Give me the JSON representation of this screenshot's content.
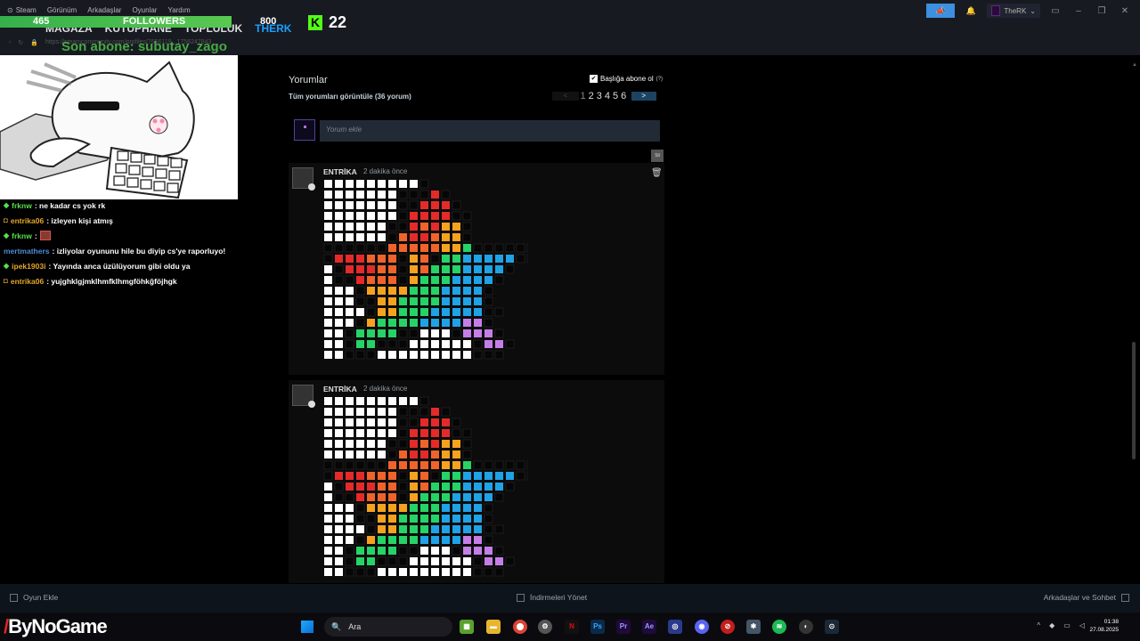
{
  "menu": {
    "app": "Steam",
    "items": [
      "Görünüm",
      "Arkadaşlar",
      "Oyunlar",
      "Yardım"
    ]
  },
  "nav": {
    "tabs": [
      "MAĞAZA",
      "KÜTÜPHANE",
      "TOPLULUK",
      "THERK"
    ],
    "active": 3
  },
  "url": "https://steamcommunity.com/profiles/7656119...1756247843",
  "overlay": {
    "followers_count": "465",
    "followers_label": "FOLLOWERS",
    "followers_goal": "800",
    "kick_logo": "K",
    "kick_count": "22",
    "last_sub": "Son abone: subutay_zago"
  },
  "window": {
    "account_name": "TheRK",
    "account_chevron": "⌄"
  },
  "chat": [
    {
      "user": "frknw",
      "msg": ": ne kadar cs yok rk",
      "color": "#57e04b",
      "badge": "diamond"
    },
    {
      "user": "entrika06",
      "msg": ": izleyen kişi atmış",
      "color": "#e5a72a",
      "badge": "sub"
    },
    {
      "user": "frknw",
      "msg": ":",
      "color": "#57e04b",
      "badge": "diamond",
      "emote": true
    },
    {
      "user": "mertmathers",
      "msg": ": izliyolar oyununu hile bu diyip cs'ye raporluyo!",
      "color": "#4f8bd8",
      "badge": ""
    },
    {
      "user": "ipek1903i",
      "msg": ": Yayında anca üzülüyorum gibi oldu ya",
      "color": "#e5a72a",
      "badge": "diamond"
    },
    {
      "user": "entrika06",
      "msg": ": yujghklgjmklhmfklhmgföhkğföjhgk",
      "color": "#e5a72a",
      "badge": "sub"
    }
  ],
  "comments_section": {
    "title": "Yorumlar",
    "subtitle": "Tüm yorumları görüntüle (36 yorum)",
    "subscribe_label": "Başlığa abone ol",
    "subscribe_help": "(?)",
    "pages": [
      "1",
      "2",
      "3",
      "4",
      "5",
      "6"
    ],
    "current_page": "1",
    "prev": "<",
    "next": ">",
    "input_placeholder": "Yorum ekle",
    "delete_label": "Sil"
  },
  "comments": [
    {
      "author": "ENTRİKA",
      "time": "2 dakika önce"
    },
    {
      "author": "ENTRİKA",
      "time": "2 dakika önce"
    }
  ],
  "pixel_art": {
    "palette": {
      "W": "#ffffff",
      "K": "#060606",
      "R": "#e52a2a",
      "O": "#f0632a",
      "Y": "#f6a21e",
      "G": "#25d366",
      "B": "#1fa2e6",
      "P": "#c57ee8"
    },
    "rows": [
      "WWWWWWWWWK",
      "WWWWWWWKKKRK",
      "WWWWWWWKKRRRK",
      "WWWWWWWKRRRRKK",
      "WWWWWWKKRORYYK",
      "WWWWWWKORROYYK",
      "KKKKKKOOOOOYYGKKKKKKK",
      "KRRROOOKYOKGGBBBBBKK",
      "WKRRROOKYOGGGBBBBK",
      "WKKROOOKYGGGBBBBK",
      "WWWKYYYYGGGBBBBK",
      "WWWKKYYGGGGBBBBK",
      "WWWWKYYGGGBBBBBKK",
      "WWWKYGGGGBBBBPPK",
      "WWKGGGGKKWWWKPPPK",
      "WWKGGKKKWWWWWWKPPK",
      "WWKKKWWWWWWWWWKKK"
    ]
  },
  "bottom": {
    "add_game": "Oyun Ekle",
    "downloads": "İndirmeleri Yönet",
    "friends": "Arkadaşlar ve Sohbet"
  },
  "taskbar": {
    "brand_prefix": "By",
    "brand_suffix": "NoGame",
    "search": "Ara",
    "time": "01:38",
    "date": "27.08.2025"
  }
}
